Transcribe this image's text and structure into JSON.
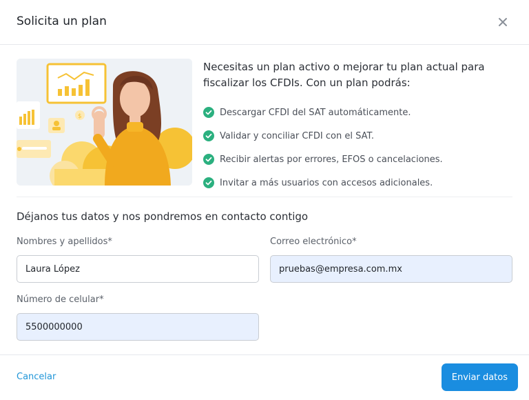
{
  "modal": {
    "title": "Solicita un plan"
  },
  "intro": {
    "text": "Necesitas un plan activo o mejorar tu plan actual para fiscalizar los CFDIs. Con un plan podrás:"
  },
  "benefits": [
    "Descargar CFDI del SAT automáticamente.",
    "Validar y conciliar CFDI con el SAT.",
    "Recibir alertas por errores, EFOS o cancelaciones.",
    "Invitar a más usuarios con accesos adicionales."
  ],
  "form": {
    "title": "Déjanos tus datos y nos pondremos en contacto contigo",
    "name_label": "Nombres y apellidos*",
    "name_value": "Laura López",
    "email_label": "Correo electrónico*",
    "email_value": "pruebas@empresa.com.mx",
    "phone_label": "Número de celular*",
    "phone_value": "5500000000"
  },
  "footer": {
    "cancel_label": "Cancelar",
    "submit_label": "Enviar datos"
  },
  "colors": {
    "primary": "#1a8de0",
    "check": "#2bb07f",
    "illustration_accent": "#f6c235"
  },
  "icons": {
    "close": "close-icon",
    "check": "check-circle-icon"
  }
}
